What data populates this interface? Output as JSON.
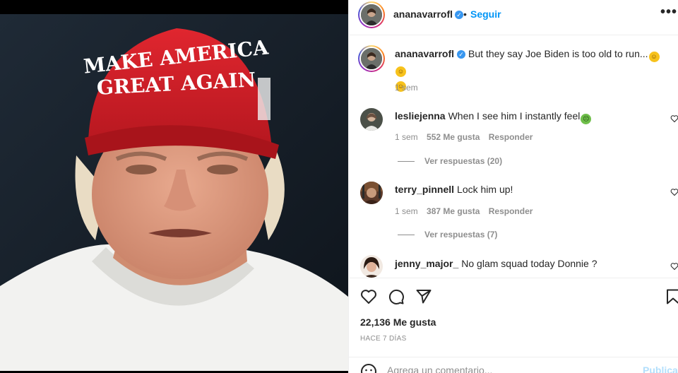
{
  "post": {
    "author": "ananavarrofl",
    "follow_label": "Seguir",
    "more_label": "•••",
    "dot": "•",
    "caption": "But they say Joe Biden is too old to run...",
    "caption_time": "1 sem",
    "verified_glyph": "✓",
    "likes": "22,136 Me gusta",
    "date": "HACE 7 DÍAS",
    "photo_hat_line1": "MAKE AMERICA",
    "photo_hat_line2": "GREAT AGAIN"
  },
  "comments": [
    {
      "username": "lesliejenna",
      "text": "When I see him I instantly feel",
      "time": "1 sem",
      "likes": "552 Me gusta",
      "reply_label": "Responder",
      "view_replies": "Ver respuestas (20)"
    },
    {
      "username": "terry_pinnell",
      "text": "Lock him up!",
      "time": "1 sem",
      "likes": "387 Me gusta",
      "reply_label": "Responder",
      "view_replies": "Ver respuestas (7)"
    },
    {
      "username": "jenny_major_",
      "text": "No glam squad today Donnie ?"
    }
  ],
  "comment_box": {
    "placeholder": "Agrega un comentario...",
    "publish_label": "Publicar"
  },
  "icons": {
    "like": "heart-icon",
    "comment": "comment-icon",
    "share": "paper-plane-icon",
    "save": "bookmark-icon",
    "emoji": "smiley-icon",
    "more": "more-options-icon"
  },
  "colors": {
    "link_blue": "#0095f6",
    "publish_disabled": "#b2dffc",
    "secondary_text": "#8e8e8e",
    "verified": "#3897f0",
    "hat_red": "#d11f27"
  }
}
